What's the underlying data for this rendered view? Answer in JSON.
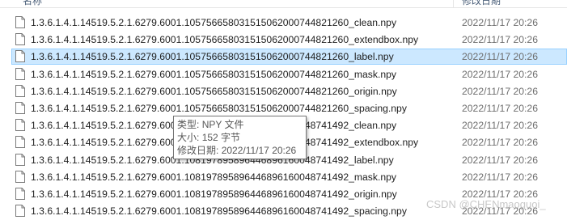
{
  "header": {
    "name_col": "名称",
    "date_col": "修改日期"
  },
  "files": [
    {
      "name": "1.3.6.1.4.1.14519.5.2.1.6279.6001.105756658031515062000744821260_clean.npy",
      "date": "2022/11/17 20:26",
      "selected": false
    },
    {
      "name": "1.3.6.1.4.1.14519.5.2.1.6279.6001.105756658031515062000744821260_extendbox.npy",
      "date": "2022/11/17 20:26",
      "selected": false
    },
    {
      "name": "1.3.6.1.4.1.14519.5.2.1.6279.6001.105756658031515062000744821260_label.npy",
      "date": "2022/11/17 20:26",
      "selected": true
    },
    {
      "name": "1.3.6.1.4.1.14519.5.2.1.6279.6001.105756658031515062000744821260_mask.npy",
      "date": "2022/11/17 20:26",
      "selected": false
    },
    {
      "name": "1.3.6.1.4.1.14519.5.2.1.6279.6001.105756658031515062000744821260_origin.npy",
      "date": "2022/11/17 20:26",
      "selected": false
    },
    {
      "name": "1.3.6.1.4.1.14519.5.2.1.6279.6001.105756658031515062000744821260_spacing.npy",
      "date": "2022/11/17 20:26",
      "selected": false
    },
    {
      "name": "1.3.6.1.4.1.14519.5.2.1.6279.6001.108197895896446896160048741492_clean.npy",
      "date": "2022/11/17 20:26",
      "selected": false
    },
    {
      "name": "1.3.6.1.4.1.14519.5.2.1.6279.6001.108197895896446896160048741492_extendbox.npy",
      "date": "2022/11/17 20:26",
      "selected": false
    },
    {
      "name": "1.3.6.1.4.1.14519.5.2.1.6279.6001.108197895896446896160048741492_label.npy",
      "date": "2022/11/17 20:26",
      "selected": false
    },
    {
      "name": "1.3.6.1.4.1.14519.5.2.1.6279.6001.108197895896446896160048741492_mask.npy",
      "date": "2022/11/17 20:26",
      "selected": false
    },
    {
      "name": "1.3.6.1.4.1.14519.5.2.1.6279.6001.108197895896446896160048741492_origin.npy",
      "date": "2022/11/17 20:26",
      "selected": false
    },
    {
      "name": "1.3.6.1.4.1.14519.5.2.1.6279.6001.108197895896446896160048741492_spacing.npy",
      "date": "2022/11/17 20:26",
      "selected": false
    }
  ],
  "tooltip": {
    "type_key": "类型:",
    "type_val": "NPY 文件",
    "size_key": "大小:",
    "size_val": "152 字节",
    "date_key": "修改日期:",
    "date_val": "2022/11/17 20:26"
  },
  "watermark": "CSDN @CHENmaoguoi_",
  "colors": {
    "selection_bg": "#cce8ff",
    "selection_border": "#99d1ff",
    "date_text": "#6d6d6d"
  },
  "icons": {
    "file": "document-icon"
  }
}
